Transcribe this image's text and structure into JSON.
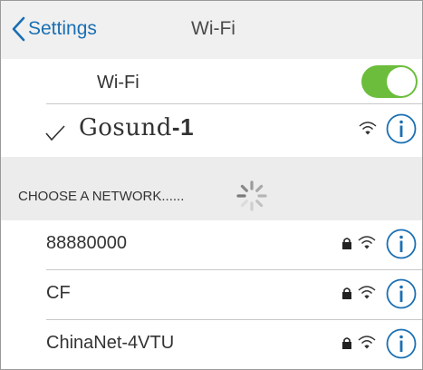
{
  "nav": {
    "back_label": "Settings",
    "title": "Wi-Fi"
  },
  "wifi_toggle": {
    "label": "Wi-Fi",
    "state": "on",
    "color": "#6cbd3c"
  },
  "connected": {
    "name": "Gosund",
    "suffix": "-1"
  },
  "section": {
    "title": "CHOOSE A NETWORK......"
  },
  "networks": [
    {
      "name": "88880000",
      "locked": true
    },
    {
      "name": "CF",
      "locked": true
    },
    {
      "name": "ChinaNet-4VTU",
      "locked": true
    }
  ],
  "icons": {
    "back": "chevron-left-icon",
    "check": "checkmark-icon",
    "wifi": "wifi-signal-icon",
    "lock": "lock-icon",
    "info": "info-icon",
    "spinner": "loading-spinner-icon"
  },
  "colors": {
    "accent": "#1a6fb3",
    "toggle_on": "#6cbd3c"
  }
}
